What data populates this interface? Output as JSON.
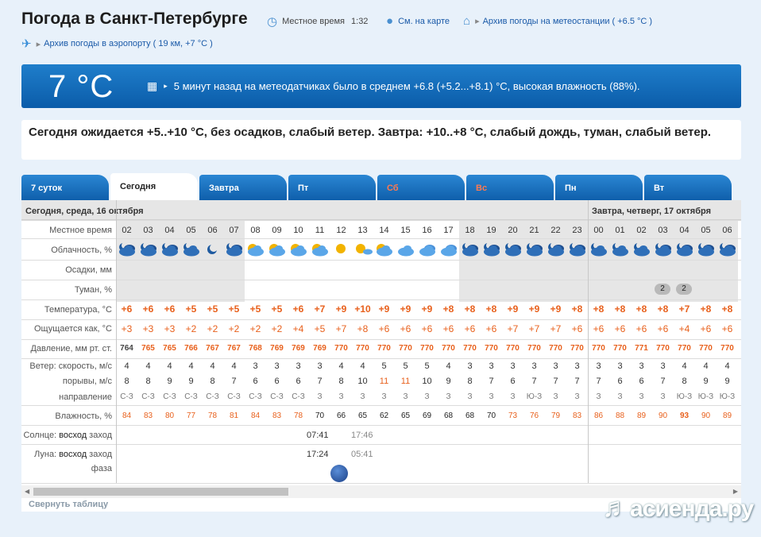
{
  "header": {
    "title": "Погода в Санкт-Петербурге",
    "local_time_label": "Местное время",
    "local_time": "1:32",
    "map_link": "См. на карте",
    "station_archive": "Архив погоды на метеостанции ( +6.5 °C )",
    "airport_archive": "Архив погоды в аэропорту ( 19 км, +7 °C )"
  },
  "now": {
    "temperature": "7 °C",
    "text": "5 минут назад на метеодатчиках было в среднем +6.8 (+5.2...+8.1) °C, высокая влажность (88%)."
  },
  "forecast_summary": "Сегодня ожидается +5..+10 °C, без осадков, слабый ветер. Завтра: +10..+8 °C, слабый дождь, туман, слабый ветер.",
  "tabs": [
    {
      "label": "7 суток",
      "active": false,
      "weekend": false
    },
    {
      "label": "Сегодня",
      "active": true,
      "weekend": false
    },
    {
      "label": "Завтра",
      "active": false,
      "weekend": false
    },
    {
      "label": "Пт",
      "active": false,
      "weekend": false
    },
    {
      "label": "Сб",
      "active": false,
      "weekend": true
    },
    {
      "label": "Вс",
      "active": false,
      "weekend": true
    },
    {
      "label": "Пн",
      "active": false,
      "weekend": false
    },
    {
      "label": "Вт",
      "active": false,
      "weekend": false
    }
  ],
  "help_icon": "?",
  "table": {
    "day1": "Сегодня, среда, 16 октября",
    "day2": "Завтра, четверг, 17 октября",
    "labels": {
      "time": "Местное время",
      "clouds": "Облачность, %",
      "precip": "Осадки, мм",
      "fog": "Туман, %",
      "temp": "Температура, °C",
      "feels": "Ощущается как, °C",
      "pressure": "Давление, мм рт. ст.",
      "wind_speed": "Ветер: скорость, м/с",
      "gusts": "порывы, м/с",
      "direction": "направление",
      "humidity": "Влажность, %",
      "sun_prefix": "Солнце:",
      "sun_rise": "восход",
      "sun_set": "заход",
      "moon_prefix": "Луна:",
      "moon_rise": "восход",
      "moon_set": "заход",
      "phase": "фаза"
    },
    "hours": [
      "02",
      "03",
      "04",
      "05",
      "06",
      "07",
      "08",
      "09",
      "10",
      "11",
      "12",
      "13",
      "14",
      "15",
      "16",
      "17",
      "18",
      "19",
      "20",
      "21",
      "22",
      "23",
      "00",
      "01",
      "02",
      "03",
      "04",
      "05",
      "06"
    ],
    "clouds": [
      "night-cloudy",
      "night-cloudy",
      "night-cloudy",
      "night-clear-cloud",
      "night-clear",
      "night-cloudy",
      "day-partly",
      "day-partly",
      "day-partly",
      "day-partly",
      "day-sun",
      "day-sun-cloud",
      "day-partly",
      "day-cloudy",
      "overcast",
      "overcast",
      "night-cloudy",
      "night-cloudy",
      "night-cloudy",
      "night-cloudy",
      "night-cloudy",
      "night-cloudy",
      "night-clear-cloud",
      "night-clear-cloud",
      "night-clear-cloud",
      "night-cloudy",
      "night-cloudy",
      "night-cloudy",
      "night-cloudy"
    ],
    "fog": [
      "",
      "",
      "",
      "",
      "",
      "",
      "",
      "",
      "",
      "",
      "",
      "",
      "",
      "",
      "",
      "",
      "",
      "",
      "",
      "",
      "",
      "",
      "",
      "",
      "",
      "2",
      "2",
      "",
      ""
    ],
    "temp": [
      "+6",
      "+6",
      "+6",
      "+5",
      "+5",
      "+5",
      "+5",
      "+5",
      "+6",
      "+7",
      "+9",
      "+10",
      "+9",
      "+9",
      "+9",
      "+8",
      "+8",
      "+8",
      "+9",
      "+9",
      "+9",
      "+8",
      "+8",
      "+8",
      "+8",
      "+8",
      "+7",
      "+8",
      "+8"
    ],
    "feels": [
      "+3",
      "+3",
      "+3",
      "+2",
      "+2",
      "+2",
      "+2",
      "+2",
      "+4",
      "+5",
      "+7",
      "+8",
      "+6",
      "+6",
      "+6",
      "+6",
      "+6",
      "+6",
      "+7",
      "+7",
      "+7",
      "+6",
      "+6",
      "+6",
      "+6",
      "+6",
      "+4",
      "+6",
      "+6"
    ],
    "pressure": [
      "764",
      "765",
      "765",
      "766",
      "767",
      "767",
      "768",
      "769",
      "769",
      "769",
      "770",
      "770",
      "770",
      "770",
      "770",
      "770",
      "770",
      "770",
      "770",
      "770",
      "770",
      "770",
      "770",
      "770",
      "771",
      "770",
      "770",
      "770",
      "770"
    ],
    "wind": [
      "4",
      "4",
      "4",
      "4",
      "4",
      "4",
      "3",
      "3",
      "3",
      "3",
      "4",
      "4",
      "5",
      "5",
      "5",
      "4",
      "3",
      "3",
      "3",
      "3",
      "3",
      "3",
      "3",
      "3",
      "3",
      "3",
      "4",
      "4",
      "4"
    ],
    "gusts": [
      "8",
      "8",
      "9",
      "9",
      "8",
      "7",
      "6",
      "6",
      "6",
      "7",
      "8",
      "10",
      "11",
      "11",
      "10",
      "9",
      "8",
      "7",
      "6",
      "7",
      "7",
      "7",
      "7",
      "6",
      "6",
      "7",
      "8",
      "9",
      "9"
    ],
    "direction": [
      "С-З",
      "С-З",
      "С-З",
      "С-З",
      "С-З",
      "С-З",
      "С-З",
      "С-З",
      "С-З",
      "З",
      "З",
      "З",
      "З",
      "З",
      "З",
      "З",
      "З",
      "З",
      "З",
      "Ю-З",
      "З",
      "З",
      "З",
      "З",
      "З",
      "З",
      "Ю-З",
      "Ю-З",
      "Ю-З"
    ],
    "humidity": [
      "84",
      "83",
      "80",
      "77",
      "78",
      "81",
      "84",
      "83",
      "78",
      "70",
      "66",
      "65",
      "62",
      "65",
      "69",
      "68",
      "68",
      "70",
      "73",
      "76",
      "79",
      "83",
      "86",
      "88",
      "89",
      "90",
      "93",
      "90",
      "89"
    ],
    "sun_rise": "07:41",
    "sun_set": "17:46",
    "moon_rise": "17:24",
    "moon_set": "05:41"
  },
  "collapse_label": "Свернуть таблицу",
  "watermark": "асиенда.ру"
}
